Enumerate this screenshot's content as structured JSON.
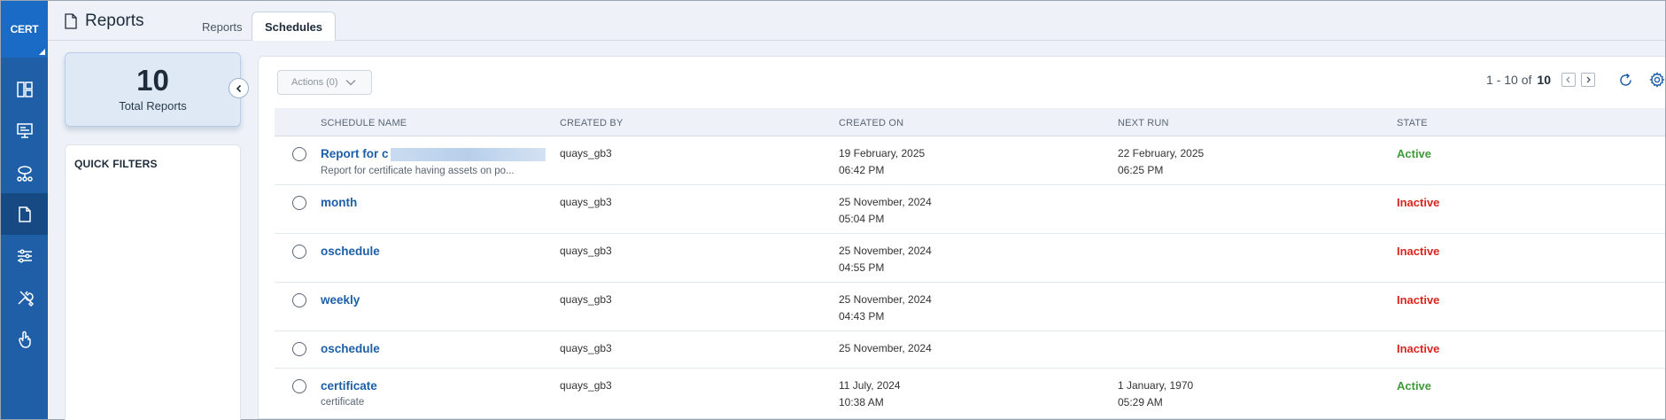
{
  "brand": {
    "label": "CERT"
  },
  "nav": {
    "items": [
      {
        "icon": "dashboard-icon"
      },
      {
        "icon": "monitor-icon"
      },
      {
        "icon": "network-icon"
      },
      {
        "icon": "document-icon",
        "active": true
      },
      {
        "icon": "sliders-icon"
      },
      {
        "icon": "tools-icon"
      },
      {
        "icon": "hand-pointer-icon"
      }
    ]
  },
  "header": {
    "title": "Reports",
    "tabs": [
      {
        "label": "Reports"
      },
      {
        "label": "Schedules",
        "active": true
      }
    ]
  },
  "summary": {
    "count": "10",
    "label": "Total Reports"
  },
  "filters": {
    "title": "QUICK FILTERS"
  },
  "toolbar": {
    "actions_label": "Actions (0)",
    "pager_range": "1 - 10 of",
    "pager_total": "10"
  },
  "table": {
    "headers": [
      "SCHEDULE NAME",
      "CREATED BY",
      "CREATED ON",
      "NEXT RUN",
      "STATE"
    ],
    "rows": [
      {
        "name": "Report for c",
        "redacted": true,
        "desc": "Report for certificate having assets on po...",
        "created_by": "quays_gb3",
        "created_on_date": "19 February, 2025",
        "created_on_time": "06:42 PM",
        "next_run_date": "22 February, 2025",
        "next_run_time": "06:25 PM",
        "state": "Active"
      },
      {
        "name": "month",
        "desc": "",
        "created_by": "quays_gb3",
        "created_on_date": "25 November, 2024",
        "created_on_time": "05:04 PM",
        "next_run_date": "",
        "next_run_time": "",
        "state": "Inactive"
      },
      {
        "name": "oschedule",
        "desc": "",
        "created_by": "quays_gb3",
        "created_on_date": "25 November, 2024",
        "created_on_time": "04:55 PM",
        "next_run_date": "",
        "next_run_time": "",
        "state": "Inactive"
      },
      {
        "name": "weekly",
        "desc": "",
        "created_by": "quays_gb3",
        "created_on_date": "25 November, 2024",
        "created_on_time": "04:43 PM",
        "next_run_date": "",
        "next_run_time": "",
        "state": "Inactive"
      },
      {
        "name": "oschedule",
        "desc": "",
        "created_by": "quays_gb3",
        "created_on_date": "25 November, 2024",
        "created_on_time": "",
        "next_run_date": "",
        "next_run_time": "",
        "state": "Inactive"
      },
      {
        "name": "certificate",
        "desc": "certificate",
        "created_by": "quays_gb3",
        "created_on_date": "11 July, 2024",
        "created_on_time": "10:38 AM",
        "next_run_date": "1 January, 1970",
        "next_run_time": "05:29 AM",
        "state": "Active"
      }
    ]
  },
  "colors": {
    "brand": "#1f5fa8",
    "active": "#3f9a3a",
    "inactive": "#d9261c",
    "link": "#1c5fa8"
  }
}
